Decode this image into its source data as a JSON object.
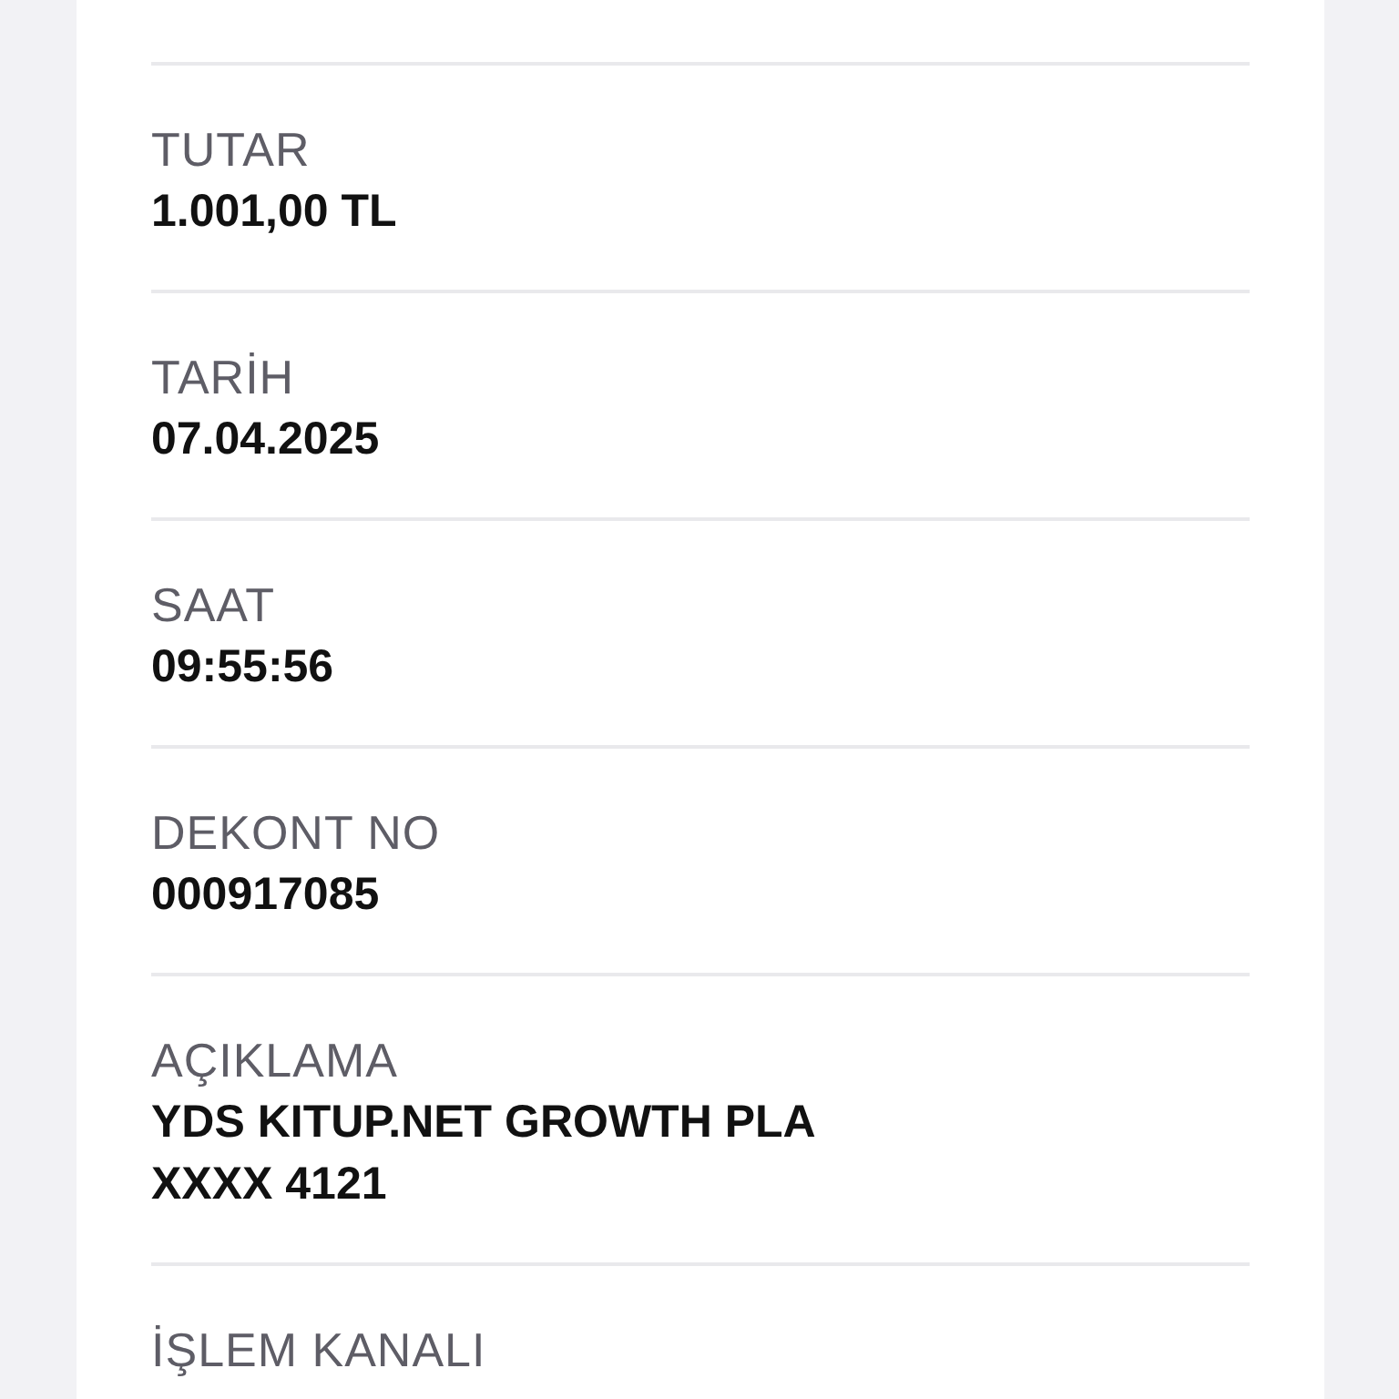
{
  "fields": [
    {
      "label": "TUTAR",
      "value_lines": [
        "1.001,00 TL"
      ]
    },
    {
      "label": "TARİH",
      "value_lines": [
        "07.04.2025"
      ]
    },
    {
      "label": "SAAT",
      "value_lines": [
        "09:55:56"
      ]
    },
    {
      "label": "DEKONT NO",
      "value_lines": [
        "000917085"
      ]
    },
    {
      "label": "AÇIKLAMA",
      "value_lines": [
        "YDS KITUP.NET GROWTH PLA",
        "XXXX 4121"
      ]
    },
    {
      "label": "İŞLEM KANALI"
    }
  ]
}
